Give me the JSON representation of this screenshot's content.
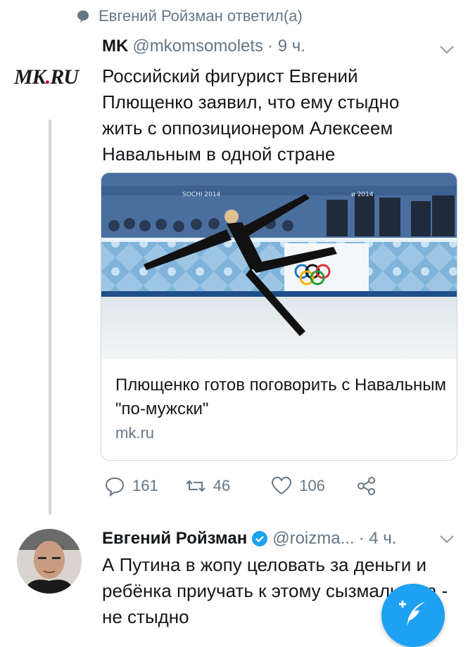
{
  "context": {
    "text": "Евгений Ройзман ответил(а)",
    "icon": "speech-bubble-icon"
  },
  "tweet1": {
    "logo": {
      "text_left": "MK",
      "text_dot": "RU"
    },
    "name": "MK",
    "handle": "@mkomsomolets",
    "time": "· 9 ч.",
    "text": "Российский фигурист Евгений Плющенко заявил, что ему стыдно жить с оппозиционером Алексеем Навальным в одной стране",
    "card": {
      "image_alt": "figure skater photo",
      "banner_text_1": "SOCHI 2014",
      "banner_text_2": "и 2014",
      "title": "Плющенко готов поговорить с Навальным \"по-мужски\"",
      "domain": "mk.ru"
    },
    "actions": {
      "replies": "161",
      "retweets": "46",
      "likes": "106"
    }
  },
  "tweet2": {
    "name": "Евгений Ройзман",
    "handle": "@roizma...",
    "time": "· 4 ч.",
    "text": "А Путина в жопу целовать за деньги и ребёнка приучать к этому сызмальства - не стыдно"
  },
  "colors": {
    "accent": "#1da1f2",
    "muted": "#657786",
    "text": "#14171a",
    "border": "#ccd6dd"
  }
}
